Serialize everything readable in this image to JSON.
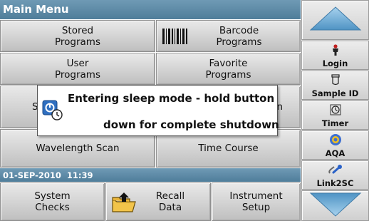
{
  "header": {
    "title": "Main Menu"
  },
  "menu": {
    "stored_programs": "Stored\nPrograms",
    "barcode_programs": "Barcode\nPrograms",
    "user_programs": "User\nPrograms",
    "favorite_programs": "Favorite\nPrograms",
    "row3_left_fragment": "S",
    "row3_right_fragment": "n",
    "wavelength_scan": "Wavelength Scan",
    "time_course": "Time Course"
  },
  "status": {
    "datetime": "01-SEP-2010  11:39"
  },
  "bottom": {
    "system_checks": "System\nChecks",
    "recall_data": "Recall\nData",
    "instrument_setup": "Instrument\nSetup"
  },
  "sidebar": {
    "login": "Login",
    "sample_id": "Sample ID",
    "timer": "Timer",
    "aqa": "AQA",
    "link2sc": "Link2SC"
  },
  "dialog": {
    "line1": "Entering sleep mode - hold button",
    "line2": "down for complete shutdown"
  },
  "colors": {
    "header_blue": "#5a87a4",
    "arrow_blue": "#6aa7d3"
  },
  "icons": [
    "barcode-icon",
    "folder-upload-icon",
    "person-icon",
    "sample-vial-icon",
    "timer-icon",
    "aqa-icon",
    "link-icon",
    "power-icon",
    "up-arrow-icon",
    "down-arrow-icon"
  ]
}
